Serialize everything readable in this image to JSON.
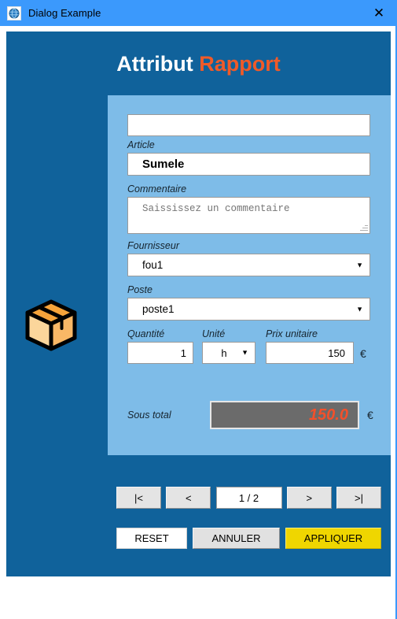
{
  "window": {
    "title": "Dialog Example",
    "app_icon": "globe-icon",
    "close_label": "✕"
  },
  "header": {
    "title_part1": "Attribut",
    "title_part2": "Rapport",
    "accent_color": "#f05a28",
    "panel_color": "#7ebce8",
    "dialog_color": "#10629b"
  },
  "illustration": {
    "name": "package-box-icon"
  },
  "form": {
    "reference": {
      "label": "",
      "value": "",
      "placeholder": ""
    },
    "article": {
      "label": "Article",
      "value": "Sumele"
    },
    "commentaire": {
      "label": "Commentaire",
      "value": "",
      "placeholder": "Saississez un commentaire"
    },
    "fournisseur": {
      "label": "Fournisseur",
      "value": "fou1",
      "arrow": "▼"
    },
    "poste": {
      "label": "Poste",
      "value": "poste1",
      "arrow": "▼"
    },
    "quantite": {
      "label": "Quantité",
      "value": "1"
    },
    "unite": {
      "label": "Unité",
      "value": "h",
      "arrow": "▼"
    },
    "prix_unitaire": {
      "label": "Prix unitaire",
      "value": "150",
      "currency": "€"
    },
    "sous_total": {
      "label": "Sous total",
      "value": "150.0",
      "currency": "€"
    }
  },
  "pagination": {
    "first_label": "|<",
    "prev_label": "<",
    "page_label": "1 / 2",
    "next_label": ">",
    "last_label": ">|"
  },
  "actions": {
    "reset_label": "RESET",
    "cancel_label": "ANNULER",
    "apply_label": "APPLIQUER",
    "apply_color": "#efd600"
  }
}
